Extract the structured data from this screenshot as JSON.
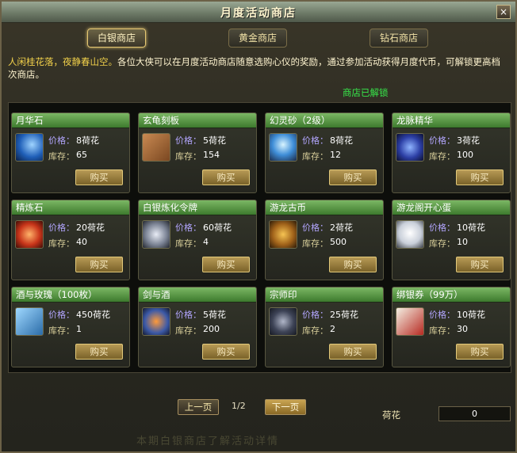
{
  "window": {
    "title": "月度活动商店",
    "close_label": "×"
  },
  "tabs": [
    {
      "label": "白银商店",
      "active": true
    },
    {
      "label": "黄金商店",
      "active": false
    },
    {
      "label": "钻石商店",
      "active": false
    }
  ],
  "intro": {
    "highlight": "人闲桂花落，夜静春山空。",
    "text": "各位大侠可以在月度活动商店随意选购心仪的奖励，通过参加活动获得月度代币，可解锁更高档次商店。"
  },
  "status": {
    "unlocked": "商店已解锁"
  },
  "labels": {
    "price": "价格：",
    "stock": "库存：",
    "buy": "购买"
  },
  "items": [
    {
      "name": "月华石",
      "price": "8荷花",
      "stock": "65",
      "icon": "crescent-moon-icon"
    },
    {
      "name": "玄龟刻板",
      "price": "5荷花",
      "stock": "154",
      "icon": "tablet-icon"
    },
    {
      "name": "幻灵砂（2级）",
      "price": "8荷花",
      "stock": "12",
      "icon": "sand-bowl-icon"
    },
    {
      "name": "龙脉精华",
      "price": "3荷花",
      "stock": "100",
      "icon": "blue-essence-icon"
    },
    {
      "name": "精炼石",
      "price": "20荷花",
      "stock": "40",
      "icon": "red-stone-icon"
    },
    {
      "name": "白银炼化令牌",
      "price": "60荷花",
      "stock": "4",
      "icon": "silver-token-icon"
    },
    {
      "name": "游龙古币",
      "price": "2荷花",
      "stock": "500",
      "icon": "dragon-coin-icon"
    },
    {
      "name": "游龙阁开心蛋",
      "price": "10荷花",
      "stock": "10",
      "icon": "egg-icon"
    },
    {
      "name": "酒与玫瑰（100枚）",
      "price": "450荷花",
      "stock": "1",
      "icon": "gift-box-icon"
    },
    {
      "name": "剑与酒",
      "price": "5荷花",
      "stock": "200",
      "icon": "sword-wine-icon"
    },
    {
      "name": "宗师印",
      "price": "25荷花",
      "stock": "2",
      "icon": "master-seal-icon"
    },
    {
      "name": "绑银券（99万）",
      "price": "10荷花",
      "stock": "30",
      "icon": "voucher-icon"
    }
  ],
  "pager": {
    "prev": "上一页",
    "page": "1/2",
    "next": "下一页"
  },
  "currency": {
    "label": "荷花",
    "value": "0"
  },
  "footer": "本期白银商店了解活动详情"
}
